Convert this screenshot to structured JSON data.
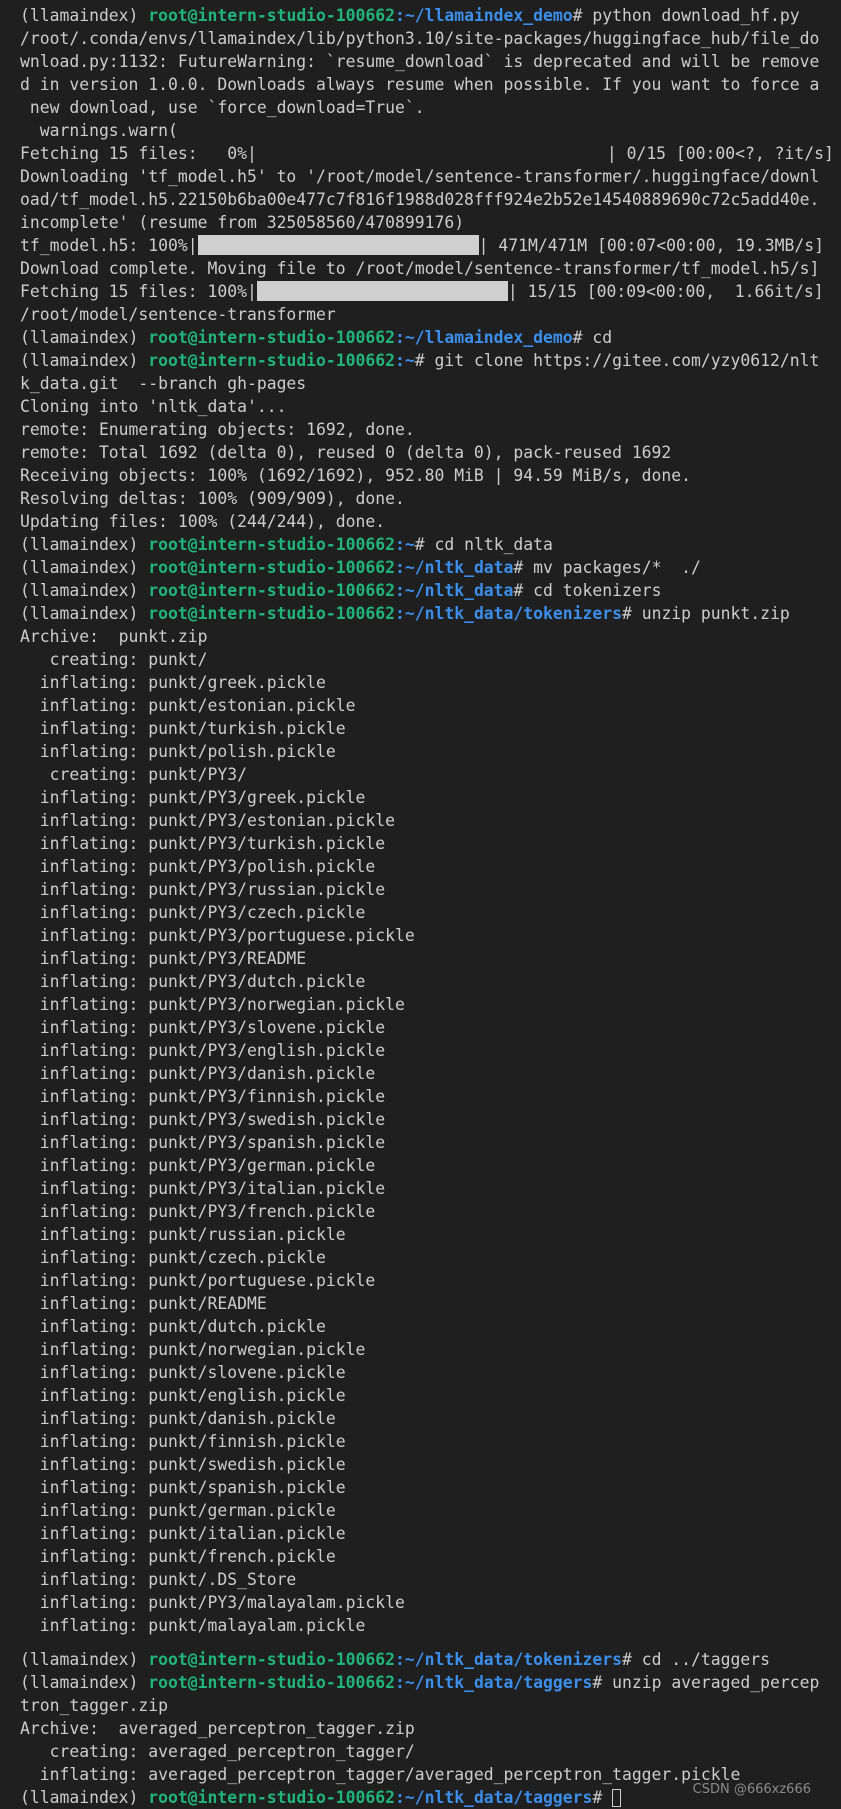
{
  "env": "(llamaindex)",
  "user_host": "root@intern-studio-100662",
  "watermark": "CSDN @666xz666",
  "paths": {
    "demo": ":~/llamaindex_demo",
    "home": ":~",
    "nltk": ":~/nltk_data",
    "tokenizers": ":~/nltk_data/tokenizers",
    "taggers": ":~/nltk_data/taggers"
  },
  "commands": {
    "download": "# python download_hf.py",
    "cd": "# cd",
    "git_clone": "# git clone https://gitee.com/yzy0612/nlt",
    "cd_nltk": "# cd nltk_data",
    "mv": "# mv packages/*  ./",
    "cd_tokenizers": "# cd tokenizers",
    "unzip_punkt": "# unzip punkt.zip",
    "cd_taggers": "# cd ../taggers",
    "unzip_tagger": "# unzip averaged_percep",
    "final_prompt": "# "
  },
  "download_output": {
    "warn1": "/root/.conda/envs/llamaindex/lib/python3.10/site-packages/huggingface_hub/file_do",
    "warn2": "wnload.py:1132: FutureWarning: `resume_download` is deprecated and will be remove",
    "warn3": "d in version 1.0.0. Downloads always resume when possible. If you want to force a",
    "warn4": " new download, use `force_download=True`.",
    "warn5": "  warnings.warn(",
    "fetch0_left": "Fetching 15 files:   0%|",
    "fetch0_right": "| 0/15 [00:00<?, ?it/s]",
    "dl1": "Downloading 'tf_model.h5' to '/root/model/sentence-transformer/.huggingface/downl",
    "dl2": "oad/tf_model.h5.22150b6ba00e477c7f816f1988d028fff924e2b52e14540889690c72c5add40e.",
    "dl3": "incomplete' (resume from 325058560/470899176)",
    "tf_left": "tf_model.h5: 100%|",
    "tf_right": "| 471M/471M [00:07<00:00, 19.3MB/s]",
    "complete": "Download complete. Moving file to /root/model/sentence-transformer/tf_model.h5/s]",
    "fetch15_left": "Fetching 15 files: 100%|",
    "fetch15_right": "| 15/15 [00:09<00:00,  1.66it/s]",
    "model_path": "/root/model/sentence-transformer"
  },
  "git_output": {
    "cont": "k_data.git  --branch gh-pages",
    "l1": "Cloning into 'nltk_data'...",
    "l2": "remote: Enumerating objects: 1692, done.",
    "l3": "remote: Total 1692 (delta 0), reused 0 (delta 0), pack-reused 1692",
    "l4": "Receiving objects: 100% (1692/1692), 952.80 MiB | 94.59 MiB/s, done.",
    "l5": "Resolving deltas: 100% (909/909), done.",
    "l6": "Updating files: 100% (244/244), done."
  },
  "punkt_output": [
    "Archive:  punkt.zip",
    "   creating: punkt/",
    "  inflating: punkt/greek.pickle",
    "  inflating: punkt/estonian.pickle",
    "  inflating: punkt/turkish.pickle",
    "  inflating: punkt/polish.pickle",
    "   creating: punkt/PY3/",
    "  inflating: punkt/PY3/greek.pickle",
    "  inflating: punkt/PY3/estonian.pickle",
    "  inflating: punkt/PY3/turkish.pickle",
    "  inflating: punkt/PY3/polish.pickle",
    "  inflating: punkt/PY3/russian.pickle",
    "  inflating: punkt/PY3/czech.pickle",
    "  inflating: punkt/PY3/portuguese.pickle",
    "  inflating: punkt/PY3/README",
    "  inflating: punkt/PY3/dutch.pickle",
    "  inflating: punkt/PY3/norwegian.pickle",
    "  inflating: punkt/PY3/slovene.pickle",
    "  inflating: punkt/PY3/english.pickle",
    "  inflating: punkt/PY3/danish.pickle",
    "  inflating: punkt/PY3/finnish.pickle",
    "  inflating: punkt/PY3/swedish.pickle",
    "  inflating: punkt/PY3/spanish.pickle",
    "  inflating: punkt/PY3/german.pickle",
    "  inflating: punkt/PY3/italian.pickle",
    "  inflating: punkt/PY3/french.pickle",
    "  inflating: punkt/russian.pickle",
    "  inflating: punkt/czech.pickle",
    "  inflating: punkt/portuguese.pickle",
    "  inflating: punkt/README",
    "  inflating: punkt/dutch.pickle",
    "  inflating: punkt/norwegian.pickle",
    "  inflating: punkt/slovene.pickle",
    "  inflating: punkt/english.pickle",
    "  inflating: punkt/danish.pickle",
    "  inflating: punkt/finnish.pickle",
    "  inflating: punkt/swedish.pickle",
    "  inflating: punkt/spanish.pickle",
    "  inflating: punkt/german.pickle",
    "  inflating: punkt/italian.pickle",
    "  inflating: punkt/french.pickle",
    "  inflating: punkt/.DS_Store",
    "  inflating: punkt/PY3/malayalam.pickle",
    "  inflating: punkt/malayalam.pickle"
  ],
  "tagger_output": {
    "cont": "tron_tagger.zip",
    "l1": "Archive:  averaged_perceptron_tagger.zip",
    "l2": "   creating: averaged_perceptron_tagger/",
    "l3": "  inflating: averaged_perceptron_tagger/averaged_perceptron_tagger.pickle"
  }
}
